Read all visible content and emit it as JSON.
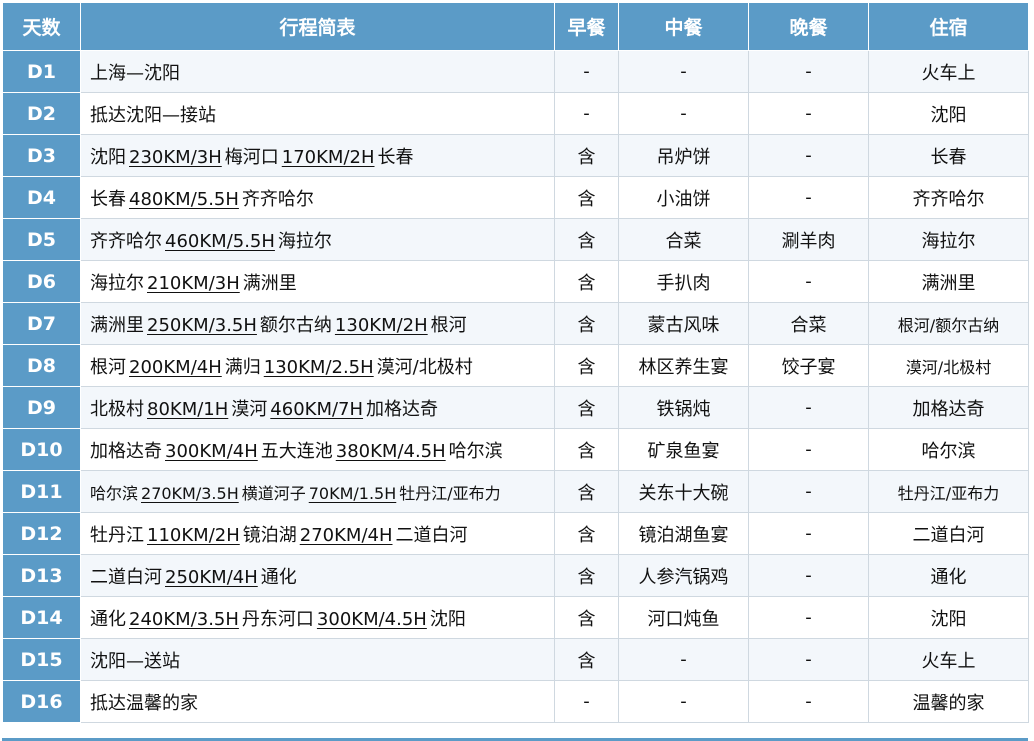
{
  "headers": [
    "天数",
    "行程简表",
    "早餐",
    "中餐",
    "晚餐",
    "住宿"
  ],
  "rows": [
    {
      "day": "D1",
      "route": [
        {
          "t": "上海—沈阳",
          "d": false
        }
      ],
      "breakfast": "-",
      "lunch": "-",
      "dinner": "-",
      "lodging": "火车上"
    },
    {
      "day": "D2",
      "route": [
        {
          "t": "抵达沈阳—接站",
          "d": false
        }
      ],
      "breakfast": "-",
      "lunch": "-",
      "dinner": "-",
      "lodging": "沈阳"
    },
    {
      "day": "D3",
      "route": [
        {
          "t": "沈阳",
          "d": false
        },
        {
          "t": "230KM/3H",
          "d": true
        },
        {
          "t": "梅河口",
          "d": false
        },
        {
          "t": "170KM/2H",
          "d": true
        },
        {
          "t": "长春",
          "d": false
        }
      ],
      "breakfast": "含",
      "lunch": "吊炉饼",
      "dinner": "-",
      "lodging": "长春"
    },
    {
      "day": "D4",
      "route": [
        {
          "t": "长春",
          "d": false
        },
        {
          "t": "480KM/5.5H",
          "d": true
        },
        {
          "t": "齐齐哈尔",
          "d": false
        }
      ],
      "breakfast": "含",
      "lunch": "小油饼",
      "dinner": "-",
      "lodging": "齐齐哈尔"
    },
    {
      "day": "D5",
      "route": [
        {
          "t": "齐齐哈尔",
          "d": false
        },
        {
          "t": "460KM/5.5H",
          "d": true
        },
        {
          "t": "海拉尔",
          "d": false
        }
      ],
      "breakfast": "含",
      "lunch": "合菜",
      "dinner": "涮羊肉",
      "lodging": "海拉尔"
    },
    {
      "day": "D6",
      "route": [
        {
          "t": "海拉尔",
          "d": false
        },
        {
          "t": "210KM/3H",
          "d": true
        },
        {
          "t": "满洲里",
          "d": false
        }
      ],
      "breakfast": "含",
      "lunch": "手扒肉",
      "dinner": "-",
      "lodging": "满洲里"
    },
    {
      "day": "D7",
      "route": [
        {
          "t": "满洲里",
          "d": false
        },
        {
          "t": "250KM/3.5H",
          "d": true
        },
        {
          "t": "额尔古纳",
          "d": false
        },
        {
          "t": "130KM/2H",
          "d": true
        },
        {
          "t": "根河",
          "d": false
        }
      ],
      "breakfast": "含",
      "lunch": "蒙古风味",
      "dinner": "合菜",
      "lodging": "根河/额尔古纳",
      "lodging_small": true
    },
    {
      "day": "D8",
      "route": [
        {
          "t": "根河",
          "d": false
        },
        {
          "t": "200KM/4H",
          "d": true
        },
        {
          "t": "满归",
          "d": false
        },
        {
          "t": "130KM/2.5H",
          "d": true
        },
        {
          "t": "漠河/北极村",
          "d": false
        }
      ],
      "breakfast": "含",
      "lunch": "林区养生宴",
      "dinner": "饺子宴",
      "lodging": "漠河/北极村",
      "lodging_small": true
    },
    {
      "day": "D9",
      "route": [
        {
          "t": "北极村",
          "d": false
        },
        {
          "t": "80KM/1H",
          "d": true
        },
        {
          "t": "漠河",
          "d": false
        },
        {
          "t": "460KM/7H",
          "d": true
        },
        {
          "t": "加格达奇",
          "d": false
        }
      ],
      "breakfast": "含",
      "lunch": "铁锅炖",
      "dinner": "-",
      "lodging": "加格达奇"
    },
    {
      "day": "D10",
      "route": [
        {
          "t": "加格达奇",
          "d": false
        },
        {
          "t": "300KM/4H",
          "d": true
        },
        {
          "t": "五大连池",
          "d": false
        },
        {
          "t": "380KM/4.5H",
          "d": true
        },
        {
          "t": "哈尔滨",
          "d": false
        }
      ],
      "breakfast": "含",
      "lunch": "矿泉鱼宴",
      "dinner": "-",
      "lodging": "哈尔滨"
    },
    {
      "day": "D11",
      "route": [
        {
          "t": "哈尔滨",
          "d": false
        },
        {
          "t": "270KM/3.5H",
          "d": true
        },
        {
          "t": "横道河子",
          "d": false
        },
        {
          "t": "70KM/1.5H",
          "d": true
        },
        {
          "t": "牡丹江/亚布力",
          "d": false
        }
      ],
      "route_small": true,
      "breakfast": "含",
      "lunch": "关东十大碗",
      "dinner": "-",
      "lodging": "牡丹江/亚布力",
      "lodging_small": true
    },
    {
      "day": "D12",
      "route": [
        {
          "t": "牡丹江",
          "d": false
        },
        {
          "t": "110KM/2H",
          "d": true
        },
        {
          "t": "镜泊湖",
          "d": false
        },
        {
          "t": "270KM/4H",
          "d": true
        },
        {
          "t": "二道白河",
          "d": false
        }
      ],
      "breakfast": "含",
      "lunch": "镜泊湖鱼宴",
      "dinner": "-",
      "lodging": "二道白河"
    },
    {
      "day": "D13",
      "route": [
        {
          "t": "二道白河",
          "d": false
        },
        {
          "t": "250KM/4H",
          "d": true
        },
        {
          "t": "通化",
          "d": false
        }
      ],
      "breakfast": "含",
      "lunch": "人参汽锅鸡",
      "dinner": "-",
      "lodging": "通化"
    },
    {
      "day": "D14",
      "route": [
        {
          "t": "通化",
          "d": false
        },
        {
          "t": "240KM/3.5H",
          "d": true
        },
        {
          "t": "丹东河口",
          "d": false
        },
        {
          "t": "300KM/4.5H",
          "d": true
        },
        {
          "t": "沈阳",
          "d": false
        }
      ],
      "breakfast": "含",
      "lunch": "河口炖鱼",
      "dinner": "-",
      "lodging": "沈阳"
    },
    {
      "day": "D15",
      "route": [
        {
          "t": "沈阳—送站",
          "d": false
        }
      ],
      "breakfast": "含",
      "lunch": "-",
      "dinner": "-",
      "lodging": "火车上"
    },
    {
      "day": "D16",
      "route": [
        {
          "t": "抵达温馨的家",
          "d": false
        }
      ],
      "breakfast": "-",
      "lunch": "-",
      "dinner": "-",
      "lodging": "温馨的家"
    }
  ]
}
